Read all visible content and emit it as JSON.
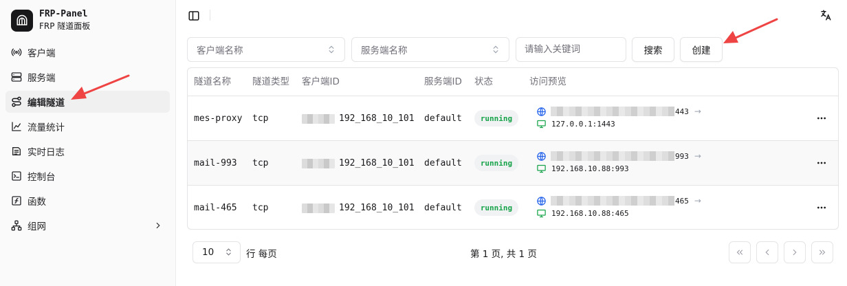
{
  "brand": {
    "name": "FRP-Panel",
    "subtitle": "FRP 隧道面板"
  },
  "sidebar": {
    "items": [
      {
        "label": "客户端",
        "icon": "radio-icon"
      },
      {
        "label": "服务端",
        "icon": "server-icon"
      },
      {
        "label": "编辑隧道",
        "icon": "route-icon",
        "active": true
      },
      {
        "label": "流量统计",
        "icon": "chart-icon"
      },
      {
        "label": "实时日志",
        "icon": "log-icon"
      },
      {
        "label": "控制台",
        "icon": "terminal-icon"
      },
      {
        "label": "函数",
        "icon": "function-icon"
      },
      {
        "label": "组网",
        "icon": "network-icon",
        "has_submenu": true
      }
    ]
  },
  "filters": {
    "client_select": {
      "placeholder": "客户端名称"
    },
    "server_select": {
      "placeholder": "服务端名称"
    },
    "keyword": {
      "placeholder": "请输入关键词",
      "value": ""
    },
    "search_label": "搜索",
    "create_label": "创建"
  },
  "table": {
    "columns": [
      "隧道名称",
      "隧道类型",
      "客户端ID",
      "服务端ID",
      "状态",
      "访问预览"
    ],
    "rows": [
      {
        "name": "mes-proxy",
        "type": "tcp",
        "client_id": "192_168_10_101",
        "server_id": "default",
        "status": "running",
        "remote_suffix": "443",
        "local": "127.0.0.1:1443"
      },
      {
        "name": "mail-993",
        "type": "tcp",
        "client_id": "192_168_10_101",
        "server_id": "default",
        "status": "running",
        "remote_suffix": "993",
        "local": "192.168.10.88:993"
      },
      {
        "name": "mail-465",
        "type": "tcp",
        "client_id": "192_168_10_101",
        "server_id": "default",
        "status": "running",
        "remote_suffix": "465",
        "local": "192.168.10.88:465"
      }
    ]
  },
  "pagination": {
    "page_size": "10",
    "rows_label": "行 每页",
    "page_info": "第 1 页, 共 1 页"
  },
  "colors": {
    "accent": "#18181b",
    "status_running": "#16a34a",
    "annotation": "#ef4444",
    "globe": "#2563eb",
    "monitor": "#16a34a"
  }
}
